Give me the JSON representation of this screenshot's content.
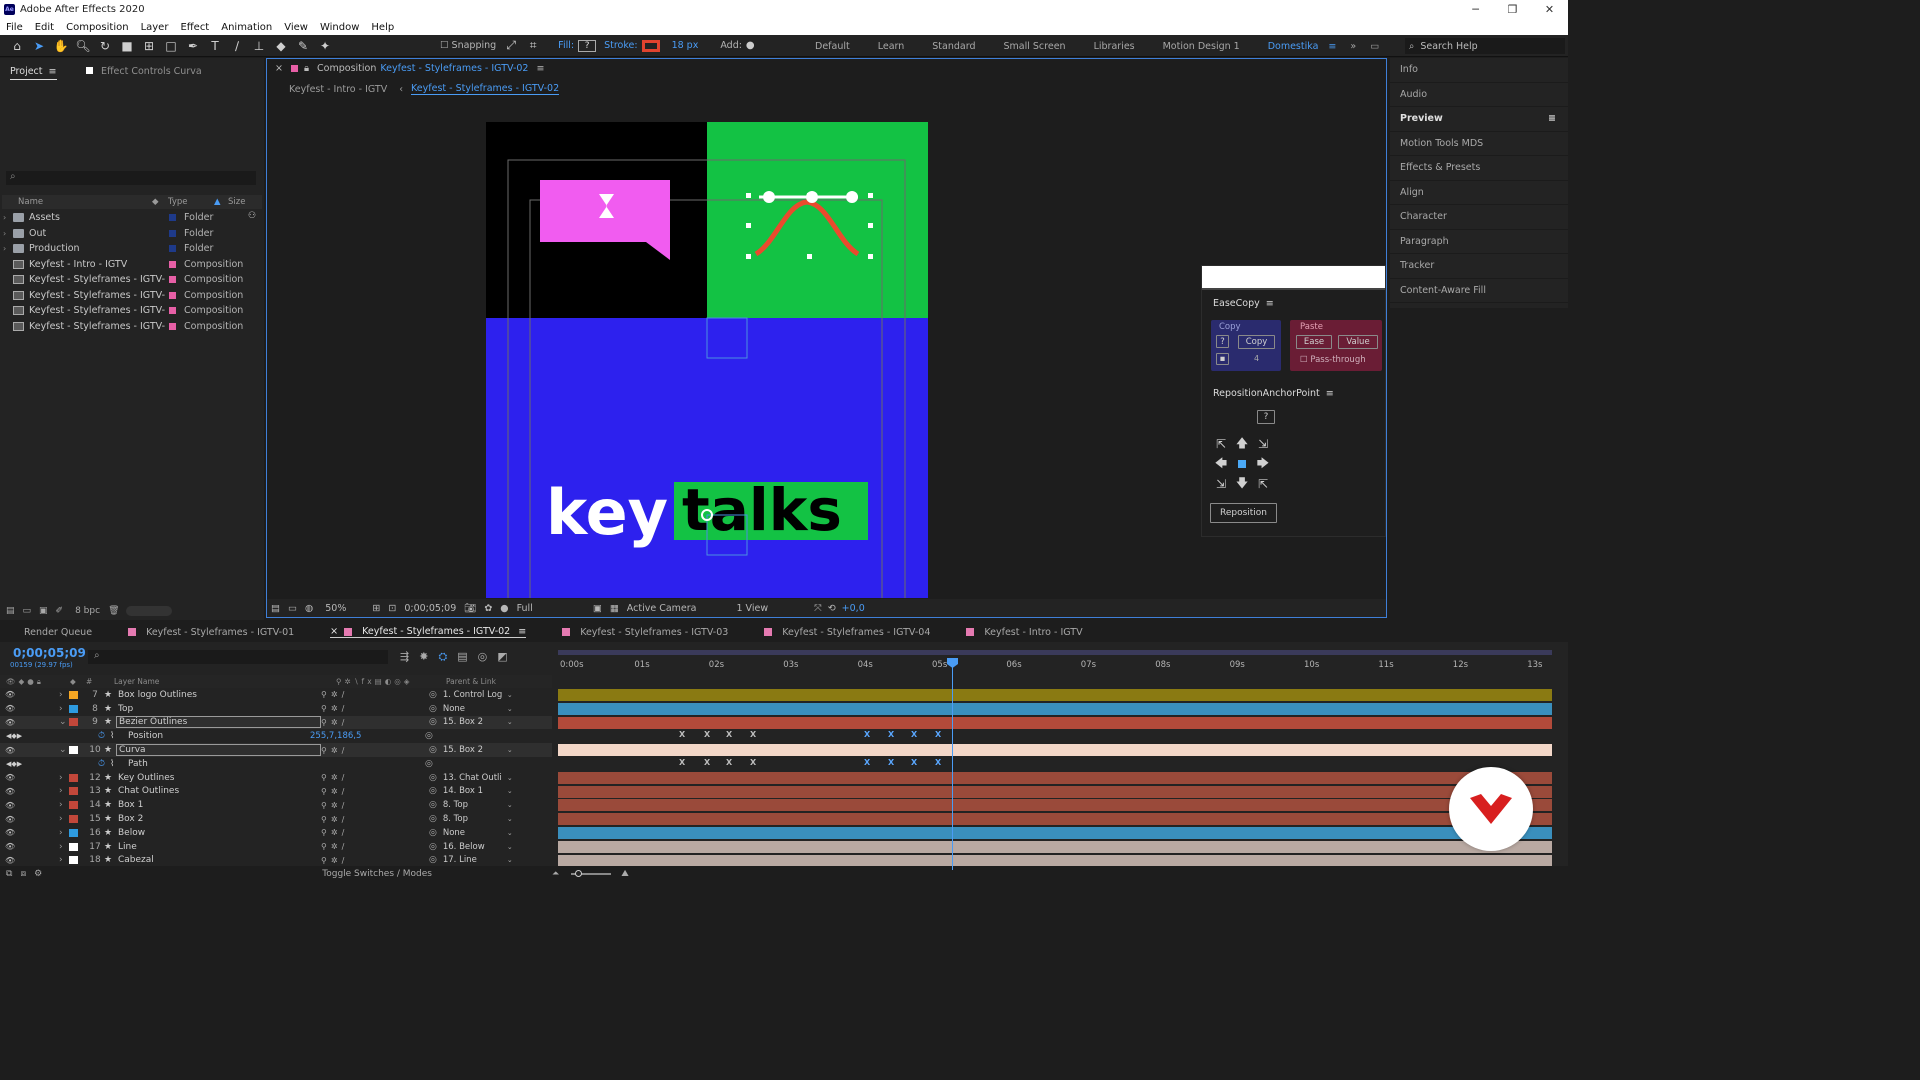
{
  "window": {
    "title": "Adobe After Effects 2020",
    "app_icon": "Ae"
  },
  "menu": [
    "File",
    "Edit",
    "Composition",
    "Layer",
    "Effect",
    "Animation",
    "View",
    "Window",
    "Help"
  ],
  "toolbar": {
    "snapping": "Snapping",
    "fill": "Fill:",
    "fill_value": "?",
    "stroke": "Stroke:",
    "stroke_px": "18 px",
    "add": "Add:",
    "workspaces": [
      "Default",
      "Learn",
      "Standard",
      "Small Screen",
      "Libraries",
      "Motion Design 1",
      "Domestika"
    ],
    "search_help": "Search Help"
  },
  "project": {
    "tab": "Project",
    "effect_controls": "Effect Controls Curva",
    "search_placeholder": "⌕",
    "columns": {
      "name": "Name",
      "type": "Type",
      "size": "Size"
    },
    "items": [
      {
        "name": "Assets",
        "type": "Folder",
        "kind": "folder",
        "color": "#1e3a8a"
      },
      {
        "name": "Out",
        "type": "Folder",
        "kind": "folder",
        "color": "#1e3a8a"
      },
      {
        "name": "Production",
        "type": "Folder",
        "kind": "folder",
        "color": "#1e3a8a"
      },
      {
        "name": "Keyfest - Intro - IGTV",
        "type": "Composition",
        "kind": "comp",
        "color": "#e75fa6"
      },
      {
        "name": "Keyfest - Styleframes - IGTV-01",
        "type": "Composition",
        "kind": "comp",
        "color": "#e75fa6"
      },
      {
        "name": "Keyfest - Styleframes - IGTV-02",
        "type": "Composition",
        "kind": "comp",
        "color": "#e75fa6"
      },
      {
        "name": "Keyfest - Styleframes - IGTV-03",
        "type": "Composition",
        "kind": "comp",
        "color": "#e75fa6"
      },
      {
        "name": "Keyfest - Styleframes - IGTV-04",
        "type": "Composition",
        "kind": "comp",
        "color": "#e75fa6"
      }
    ],
    "bpc": "8 bpc"
  },
  "composition": {
    "tab_prefix": "Composition",
    "tab_name": "Keyfest - Styleframes - IGTV-02",
    "crumb_prev": "Keyfest - Intro - IGTV",
    "crumb_cur": "Keyfest - Styleframes - IGTV-02",
    "artwork": {
      "word1": "key",
      "word2": "talks"
    },
    "footer": {
      "zoom": "50%",
      "timecode": "0;00;05;09",
      "resolution": "Full",
      "camera": "Active Camera",
      "views": "1 View",
      "exposure": "+0,0"
    }
  },
  "right_panel": {
    "items": [
      "Info",
      "Audio",
      "Preview",
      "Motion Tools MDS",
      "Effects & Presets",
      "Align",
      "Character",
      "Paragraph",
      "Tracker",
      "Content-Aware Fill"
    ],
    "active": "Preview"
  },
  "easecopy": {
    "title": "EaseCopy",
    "copy_label": "Copy",
    "copy_q": "?",
    "copy_btn": "Copy",
    "copy_count": "4",
    "paste_label": "Paste",
    "ease_btn": "Ease",
    "value_btn": "Value",
    "passthrough": "Pass-through"
  },
  "reposition": {
    "title": "RepositionAnchorPoint",
    "help": "?",
    "button": "Reposition"
  },
  "timeline_tabs": [
    {
      "name": "Render Queue",
      "swatch": false
    },
    {
      "name": "Keyfest - Styleframes - IGTV-01",
      "swatch": true
    },
    {
      "name": "Keyfest - Styleframes - IGTV-02",
      "swatch": true,
      "current": true
    },
    {
      "name": "Keyfest - Styleframes - IGTV-03",
      "swatch": true
    },
    {
      "name": "Keyfest - Styleframes - IGTV-04",
      "swatch": true
    },
    {
      "name": "Keyfest - Intro - IGTV",
      "swatch": true
    }
  ],
  "timeline": {
    "timecode": "0;00;05;09",
    "timecode_sub": "00159 (29.97 fps)",
    "headers": {
      "num": "#",
      "layer": "Layer Name",
      "parent": "Parent & Link"
    },
    "ruler": [
      "0:00s",
      "01s",
      "02s",
      "03s",
      "04s",
      "05s",
      "06s",
      "07s",
      "08s",
      "09s",
      "10s",
      "11s",
      "12s",
      "13s"
    ],
    "layers": [
      {
        "num": "7",
        "name": "Box logo Outlines",
        "color": "#f5a623",
        "parent": "1. Control Log",
        "track": "#8a7a12"
      },
      {
        "num": "8",
        "name": "Top",
        "color": "#2e9be0",
        "parent": "None",
        "track": "#3a8fbd"
      },
      {
        "num": "9",
        "name": "Bezier Outlines",
        "color": "#c2473a",
        "parent": "15. Box 2",
        "track": "#b24a3a",
        "selected": true
      },
      {
        "num": "",
        "name": "Position",
        "prop": true,
        "value": "255,7,186,5"
      },
      {
        "num": "10",
        "name": "Curva",
        "color": "#ffffff",
        "parent": "15. Box 2",
        "track": "#f3d7c8",
        "selected": true
      },
      {
        "num": "",
        "name": "Path",
        "prop": true,
        "value": ""
      },
      {
        "num": "12",
        "name": "Key Outlines",
        "color": "#c2473a",
        "parent": "13. Chat Outli",
        "track": "#9a4a3a"
      },
      {
        "num": "13",
        "name": "Chat Outlines",
        "color": "#c2473a",
        "parent": "14. Box 1",
        "track": "#9a4a3a"
      },
      {
        "num": "14",
        "name": "Box 1",
        "color": "#c2473a",
        "parent": "8. Top",
        "track": "#9a4a3a"
      },
      {
        "num": "15",
        "name": "Box 2",
        "color": "#c2473a",
        "parent": "8. Top",
        "track": "#9a4a3a"
      },
      {
        "num": "16",
        "name": "Below",
        "color": "#2e9be0",
        "parent": "None",
        "track": "#3a8fbd"
      },
      {
        "num": "17",
        "name": "Line",
        "color": "#ffffff",
        "parent": "16. Below",
        "track": "#b9a9a2"
      },
      {
        "num": "18",
        "name": "Cabezal",
        "color": "#ffffff",
        "parent": "17. Line",
        "track": "#b9a9a2"
      }
    ],
    "toggle_label": "Toggle Switches / Modes"
  }
}
